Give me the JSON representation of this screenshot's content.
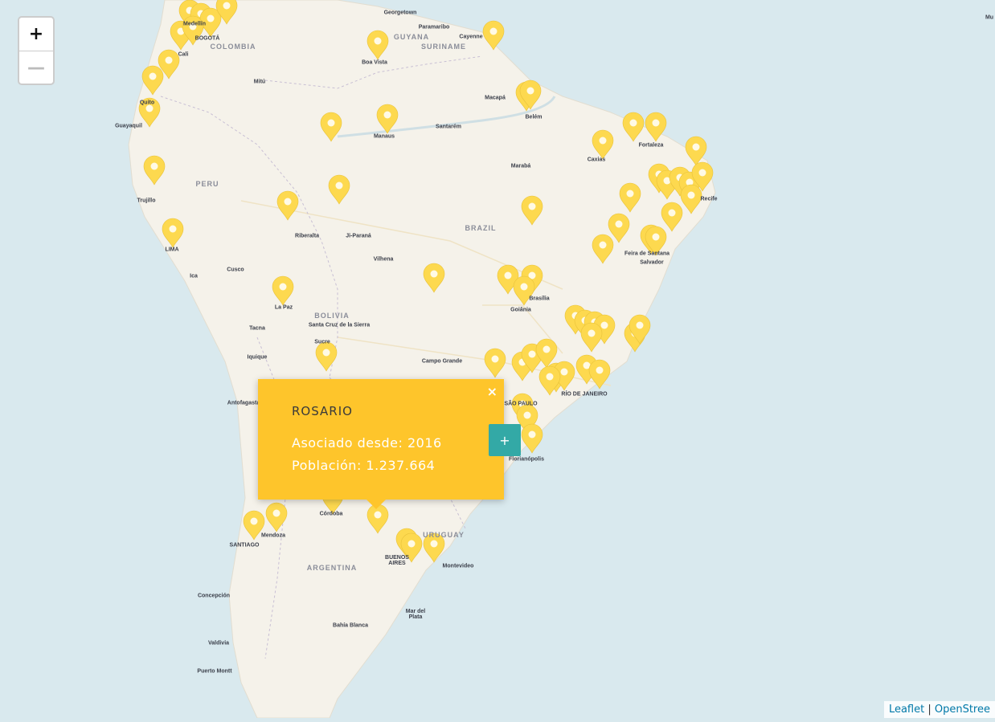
{
  "zoom": {
    "in_label": "+",
    "out_label": "—"
  },
  "labels": {
    "countries": [
      "COLOMBIA",
      "GUYANA",
      "SURINAME",
      "PERU",
      "BRAZIL",
      "BOLIVIA",
      "ARGENTINA",
      "URUGUAY"
    ],
    "cities": [
      "Georgetown",
      "Paramaribo",
      "Cayenne",
      "BOGOTÁ",
      "Cali",
      "Medellín",
      "Quito",
      "Guayaquil",
      "Mitú",
      "Boa Vista",
      "Macapá",
      "Belém",
      "Manaus",
      "Santarém",
      "Fortaleza",
      "Caxias",
      "Marabá",
      "Trujillo",
      "Recife",
      "Riberalta",
      "Ji-Paraná",
      "Vilhena",
      "LIMA",
      "Cusco",
      "Ica",
      "Feira de Santana",
      "Salvador",
      "La Paz",
      "Tacna",
      "Santa Cruz de la Sierra",
      "Sucre",
      "Goiânia",
      "Brasília",
      "Iquique",
      "Campo Grande",
      "Antofagasta",
      "RÍO DE JANEIRO",
      "SÃO PAULO",
      "Florianópolis",
      "Córdoba",
      "Mendoza",
      "SANTIAGO",
      "BUENOS AIRES",
      "Montevideo",
      "Concepción",
      "Bahía Blanca",
      "Mar del Plata",
      "Valdivia",
      "Puerto Montt",
      "Mu"
    ]
  },
  "popup": {
    "close_label": "×",
    "city": "ROSARIO",
    "member_since": "Asociado desde: 2016",
    "population": "Población: 1.237.664",
    "more_label": "+"
  },
  "attribution": {
    "leaflet": "Leaflet",
    "separator": " | ",
    "osm": "OpenStree"
  },
  "colors": {
    "marker": "#fdd94f",
    "popup_bg": "#fec52b",
    "more_button": "#33a9a6",
    "ocean": "#d9e9ee",
    "land": "#f5f2ea"
  }
}
